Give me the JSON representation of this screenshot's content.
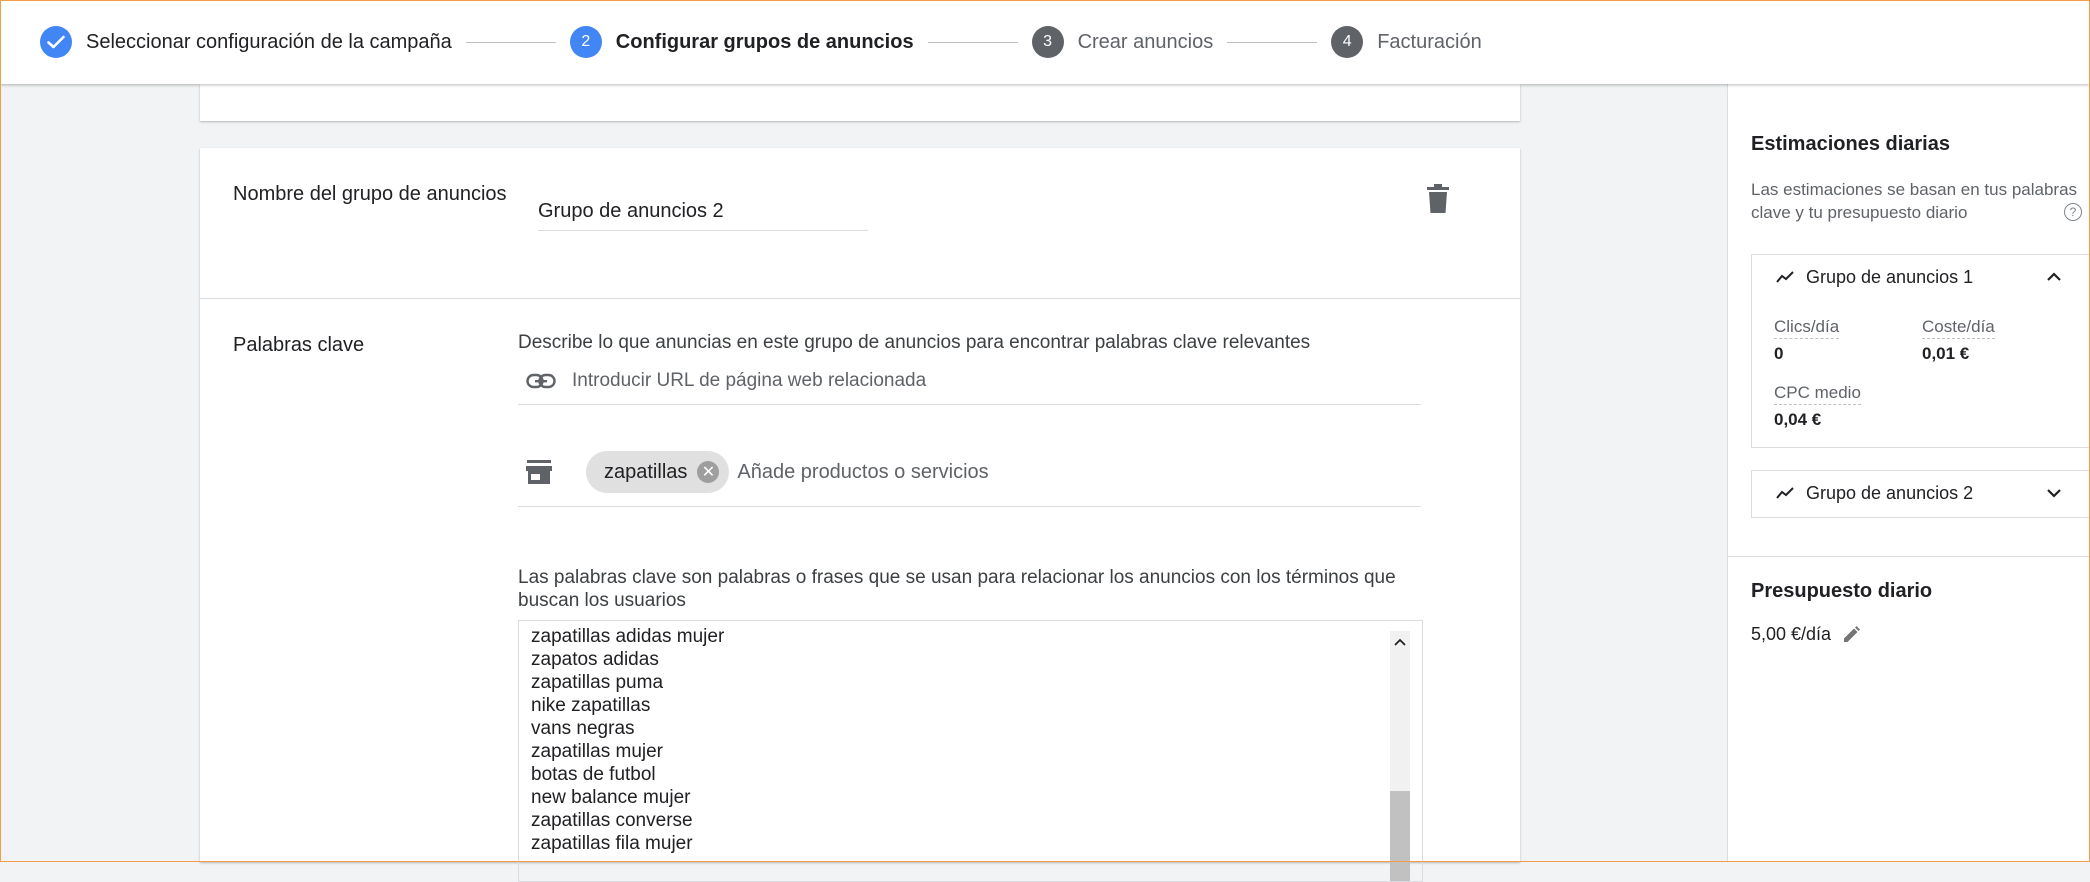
{
  "stepper": {
    "steps": [
      {
        "label": "Seleccionar configuración de la campaña",
        "number": "",
        "state": "done"
      },
      {
        "label": "Configurar grupos de anuncios",
        "number": "2",
        "state": "active"
      },
      {
        "label": "Crear anuncios",
        "number": "3",
        "state": "pending"
      },
      {
        "label": "Facturación",
        "number": "4",
        "state": "pending"
      }
    ]
  },
  "ad_group": {
    "name_label": "Nombre del grupo de anuncios",
    "name_value": "Grupo de anuncios 2"
  },
  "keywords": {
    "label": "Palabras clave",
    "describe_helper": "Describe lo que anuncias en este grupo de anuncios para encontrar palabras clave relevantes",
    "url_placeholder": "Introducir URL de página web relacionada",
    "product_chip": "zapatillas",
    "product_placeholder": "Añade productos o servicios",
    "keywords_helper": "Las palabras clave son palabras o frases que se usan para relacionar los anuncios con los términos que buscan los usuarios",
    "list": [
      "zapatillas adidas mujer",
      "zapatos adidas",
      "zapatillas puma",
      "nike zapatillas",
      "vans negras",
      "zapatillas mujer",
      "botas de futbol",
      "new balance mujer",
      "zapatillas converse",
      "zapatillas fila mujer"
    ]
  },
  "sidebar": {
    "title": "Estimaciones diarias",
    "description": "Las estimaciones se basan en tus palabras clave y tu presupuesto diario",
    "help": "?",
    "group1": {
      "name": "Grupo de anuncios 1",
      "clicks_label": "Clics/día",
      "clicks_value": "0",
      "cost_label": "Coste/día",
      "cost_value": "0,01 €",
      "cpc_label": "CPC medio",
      "cpc_value": "0,04 €"
    },
    "group2": {
      "name": "Grupo de anuncios 2"
    },
    "budget_title": "Presupuesto diario",
    "budget_value": "5,00 €/día"
  },
  "colors": {
    "accent": "#4285f4",
    "frame": "#f39c4a"
  }
}
